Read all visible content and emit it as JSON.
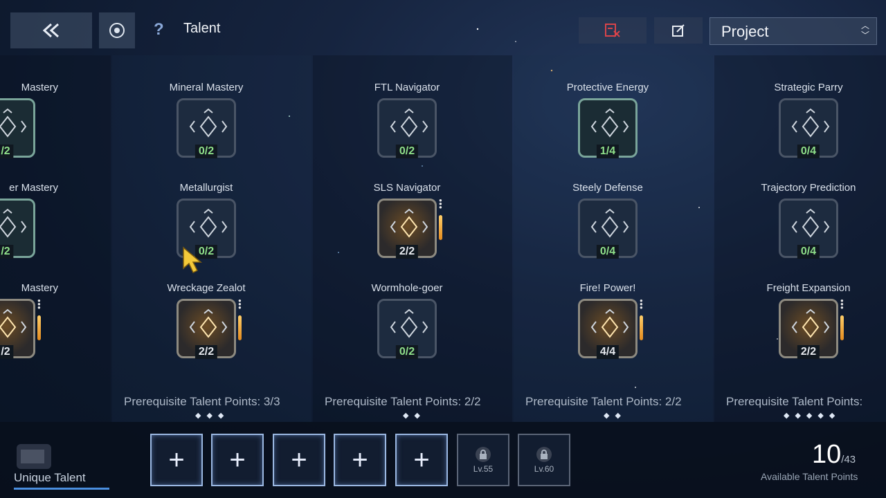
{
  "header": {
    "title": "Talent",
    "help_label": "?",
    "project_select": "Project"
  },
  "columns": [
    {
      "talents": [
        {
          "name": "Mastery",
          "count": "/2",
          "state": "green"
        },
        {
          "name": "er Mastery",
          "count": "/2",
          "state": "green"
        },
        {
          "name": "Mastery",
          "count": "/2",
          "state": "gold"
        }
      ]
    },
    {
      "talents": [
        {
          "name": "Mineral Mastery",
          "count": "0/2",
          "state": "green"
        },
        {
          "name": "Metallurgist",
          "count": "0/2",
          "state": "green"
        },
        {
          "name": "Wreckage Zealot",
          "count": "2/2",
          "state": "gold"
        }
      ],
      "prereq": "Prerequisite Talent Points: 3/3",
      "diamonds": "◆◆◆"
    },
    {
      "talents": [
        {
          "name": "FTL Navigator",
          "count": "0/2",
          "state": "green"
        },
        {
          "name": "SLS Navigator",
          "count": "2/2",
          "state": "gold"
        },
        {
          "name": "Wormhole-goer",
          "count": "0/2",
          "state": "green"
        }
      ],
      "prereq": "Prerequisite Talent Points: 2/2",
      "diamonds": "◆◆"
    },
    {
      "talents": [
        {
          "name": "Protective Energy",
          "count": "1/4",
          "state": "green"
        },
        {
          "name": "Steely Defense",
          "count": "0/4",
          "state": "plain"
        },
        {
          "name": "Fire! Power!",
          "count": "4/4",
          "state": "gold"
        }
      ],
      "prereq": "Prerequisite Talent Points: 2/2",
      "diamonds": "◆◆"
    },
    {
      "talents": [
        {
          "name": "Strategic Parry",
          "count": "0/4",
          "state": "plain"
        },
        {
          "name": "Trajectory Prediction",
          "count": "0/4",
          "state": "plain"
        },
        {
          "name": "Freight Expansion",
          "count": "2/2",
          "state": "gold"
        }
      ],
      "prereq": "Prerequisite Talent Points:",
      "diamonds": "◆◆◆◆◆"
    }
  ],
  "bottom": {
    "unique_label": "Unique Talent",
    "slots": [
      "+",
      "+",
      "+",
      "+",
      "+"
    ],
    "locked": [
      "Lv.55",
      "Lv.60"
    ],
    "points_value": "10",
    "points_total": "/43",
    "points_label": "Available Talent Points"
  }
}
